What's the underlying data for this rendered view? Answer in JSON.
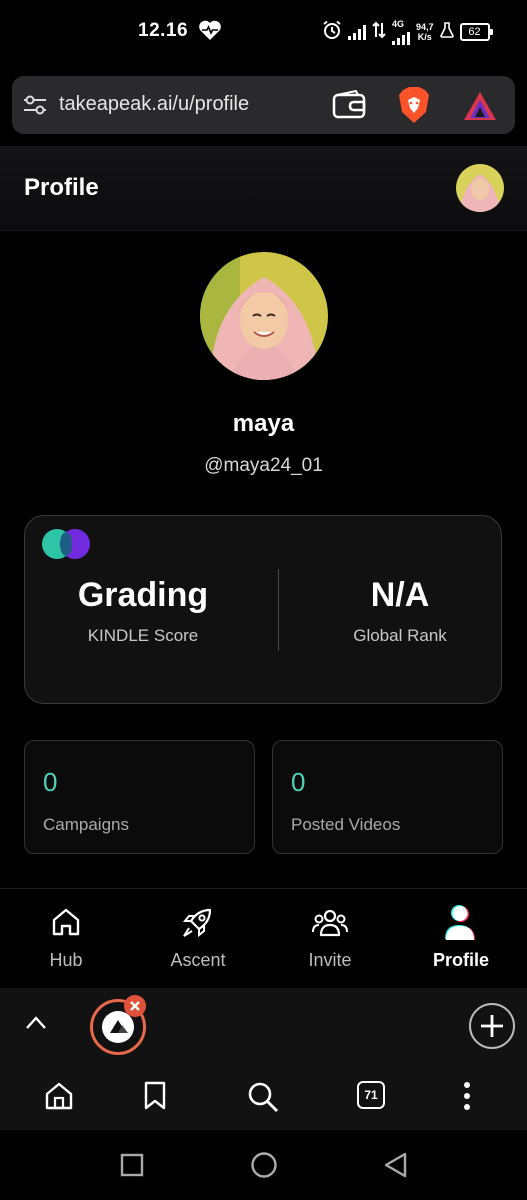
{
  "status_bar": {
    "time": "12.16",
    "network_type": "4G",
    "speed_value": "94,7",
    "speed_unit": "K/s",
    "battery": "62"
  },
  "browser": {
    "url": "takeapeak.ai/u/profile",
    "tab_count": "71"
  },
  "header": {
    "title": "Profile"
  },
  "profile": {
    "name": "maya",
    "handle": "@maya24_01"
  },
  "score_card": {
    "kindle_score_value": "Grading",
    "kindle_score_label": "KINDLE Score",
    "global_rank_value": "N/A",
    "global_rank_label": "Global Rank"
  },
  "stats": [
    {
      "value": "0",
      "label": "Campaigns"
    },
    {
      "value": "0",
      "label": "Posted Videos"
    }
  ],
  "bottom_nav": {
    "items": [
      {
        "label": "Hub",
        "icon": "home-icon"
      },
      {
        "label": "Ascent",
        "icon": "rocket-icon"
      },
      {
        "label": "Invite",
        "icon": "users-icon"
      },
      {
        "label": "Profile",
        "icon": "user-icon"
      }
    ],
    "active": "Profile"
  },
  "colors": {
    "accent_teal": "#2ec4a6",
    "accent_purple": "#7b2cf0",
    "stat_value": "#4fd1b8",
    "brave_orange": "#fb542b",
    "tab_ring": "#e8694a",
    "tab_close_badge": "#e0513a"
  }
}
